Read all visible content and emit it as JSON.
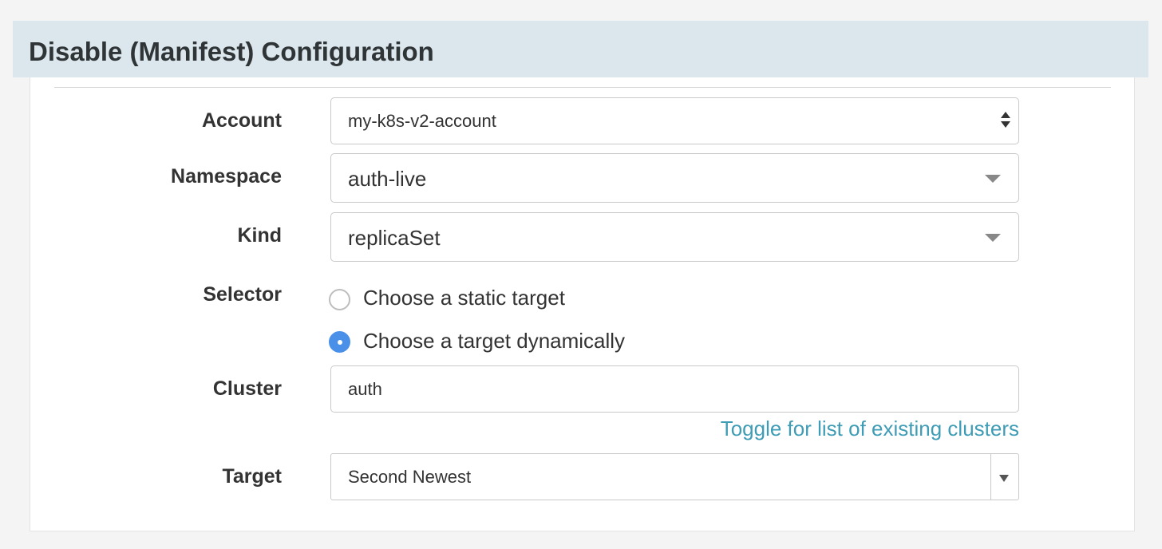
{
  "header": {
    "title": "Disable (Manifest) Configuration"
  },
  "form": {
    "account": {
      "label": "Account",
      "value": "my-k8s-v2-account"
    },
    "namespace": {
      "label": "Namespace",
      "value": "auth-live"
    },
    "kind": {
      "label": "Kind",
      "value": "replicaSet"
    },
    "selector": {
      "label": "Selector",
      "options": [
        {
          "label": "Choose a static target",
          "selected": false
        },
        {
          "label": "Choose a target dynamically",
          "selected": true
        }
      ]
    },
    "cluster": {
      "label": "Cluster",
      "value": "auth",
      "toggle_link": "Toggle for list of existing clusters"
    },
    "target": {
      "label": "Target",
      "value": "Second Newest"
    }
  },
  "colors": {
    "header_bg": "#dce7ed",
    "radio_selected": "#4a8fe8",
    "link": "#3f9cb5"
  },
  "icons": {
    "account_select": "up-down-arrows-icon",
    "namespace_select": "caret-down-icon",
    "kind_select": "caret-down-icon",
    "target_select": "caret-down-icon"
  }
}
